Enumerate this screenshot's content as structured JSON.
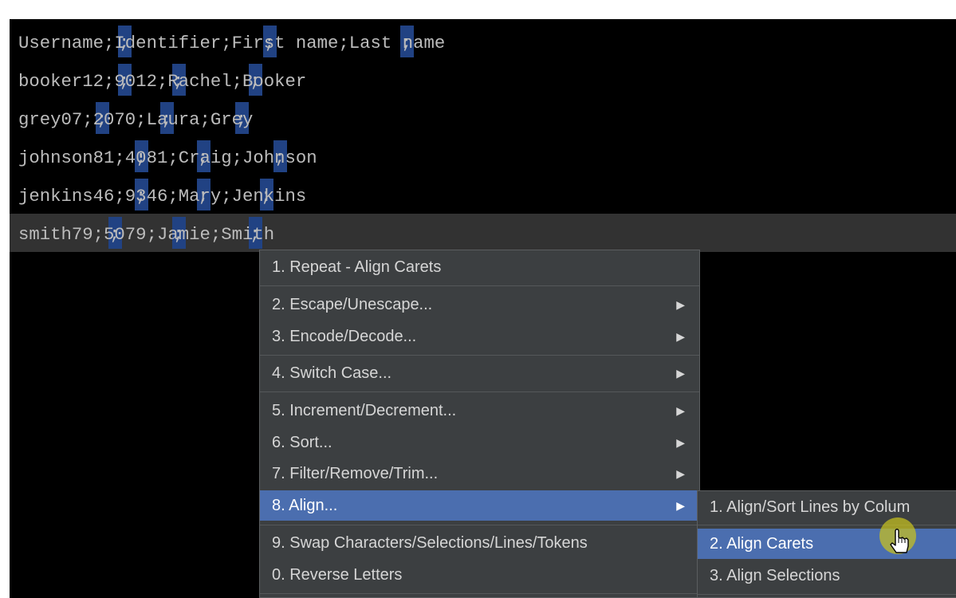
{
  "editor": {
    "lines": [
      {
        "text": "Username;Identifier;First name;Last name"
      },
      {
        "text": "booker12;9012;Rachel;Booker"
      },
      {
        "text": "grey07;2070;Laura;Grey"
      },
      {
        "text": "johnson81;4081;Craig;Johnson"
      },
      {
        "text": "jenkins46;9346;Mary;Jenkins"
      },
      {
        "text": "smith79;5079;Jamie;Smith"
      }
    ]
  },
  "context_menu": {
    "items": [
      {
        "label": "1. Repeat - Align Carets"
      },
      {
        "label": "2. Escape/Unescape...",
        "arrow": "▶"
      },
      {
        "label": "3. Encode/Decode...",
        "arrow": "▶"
      },
      {
        "label": "4. Switch Case...",
        "arrow": "▶"
      },
      {
        "label": "5. Increment/Decrement...",
        "arrow": "▶"
      },
      {
        "label": "6. Sort...",
        "arrow": "▶"
      },
      {
        "label": "7. Filter/Remove/Trim...",
        "arrow": "▶"
      },
      {
        "label": "8. Align...",
        "arrow": "▶"
      },
      {
        "label": "9. Swap Characters/Selections/Lines/Tokens"
      },
      {
        "label": "0. Reverse Letters"
      }
    ],
    "active_index": 7
  },
  "submenu": {
    "items": [
      {
        "label": "1. Align/Sort Lines by Colum"
      },
      {
        "label": "2. Align Carets"
      },
      {
        "label": "3. Align Selections"
      }
    ],
    "hovered_index": 1
  },
  "colors": {
    "editor_bg": "#000000",
    "current_line": "#323232",
    "caret_highlight": "#214283",
    "menu_bg": "#3c3f41",
    "menu_active": "#4b6eaf",
    "pointer_halo": "#c8c21e"
  }
}
